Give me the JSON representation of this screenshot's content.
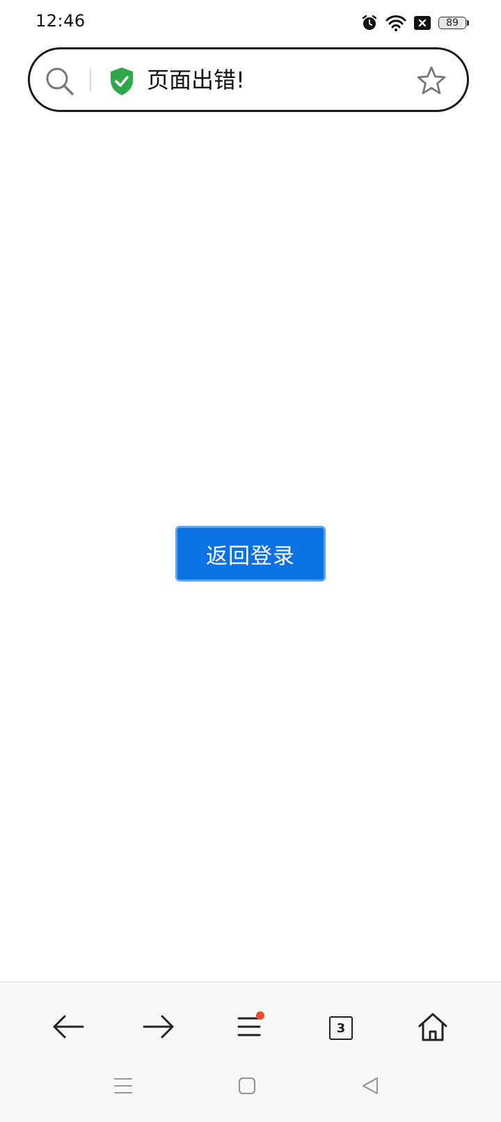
{
  "status_bar": {
    "time": "12:46",
    "battery": "89",
    "icons": [
      "alarm-icon",
      "wifi-icon",
      "no-sim-icon",
      "battery-icon"
    ]
  },
  "url_bar": {
    "title": "页面出错!",
    "icons": [
      "search-icon",
      "secure-shield-icon",
      "star-icon"
    ],
    "shield_color": "#2ea84a"
  },
  "main": {
    "return_button_label": "返回登录",
    "button_color": "#0a72e4"
  },
  "bottom_nav": {
    "items": [
      "back-arrow-icon",
      "forward-arrow-icon",
      "menu-icon",
      "tabs-icon",
      "home-icon"
    ],
    "tab_count": "3",
    "notification_dot_color": "#f04a2a"
  },
  "system_nav": {
    "items": [
      "recents-icon",
      "home-square-icon",
      "back-triangle-icon"
    ]
  }
}
